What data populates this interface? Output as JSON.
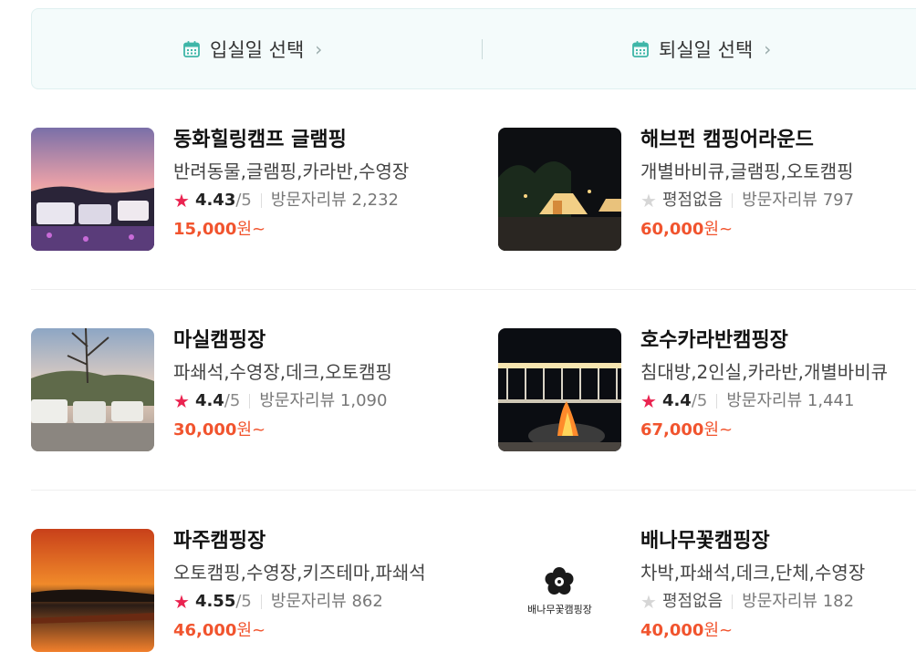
{
  "dates": {
    "checkin_label": "입실일 선택",
    "checkout_label": "퇴실일 선택"
  },
  "listings": [
    {
      "name": "동화힐링캠프 글램핑",
      "tags": "반려동물,글램핑,카라반,수영장",
      "score": "4.43",
      "max": "/5",
      "review_label": "방문자리뷰",
      "reviews": "2,232",
      "price": "15,000",
      "unit": "원~"
    },
    {
      "name": "해브펀 캠핑어라운드",
      "tags": "개별바비큐,글램핑,오토캠핑",
      "score": "",
      "noscore": "평점없음",
      "review_label": "방문자리뷰",
      "reviews": "797",
      "price": "60,000",
      "unit": "원~"
    },
    {
      "name": "마실캠핑장",
      "tags": "파쇄석,수영장,데크,오토캠핑",
      "score": "4.4",
      "max": "/5",
      "review_label": "방문자리뷰",
      "reviews": "1,090",
      "price": "30,000",
      "unit": "원~"
    },
    {
      "name": "호수카라반캠핑장",
      "tags": "침대방,2인실,카라반,개별바비큐",
      "score": "4.4",
      "max": "/5",
      "review_label": "방문자리뷰",
      "reviews": "1,441",
      "price": "67,000",
      "unit": "원~"
    },
    {
      "name": "파주캠핑장",
      "tags": "오토캠핑,수영장,키즈테마,파쇄석",
      "score": "4.55",
      "max": "/5",
      "review_label": "방문자리뷰",
      "reviews": "862",
      "price": "46,000",
      "unit": "원~"
    },
    {
      "name": "배나무꽃캠핑장",
      "tags": "차박,파쇄석,데크,단체,수영장",
      "score": "",
      "noscore": "평점없음",
      "review_label": "방문자리뷰",
      "reviews": "182",
      "price": "40,000",
      "unit": "원~",
      "logo_text": "배나무꽃캠핑장"
    }
  ],
  "colors": {
    "accent_price": "#f1542e",
    "star": "#ea2350",
    "calendar": "#3fb6a8"
  }
}
